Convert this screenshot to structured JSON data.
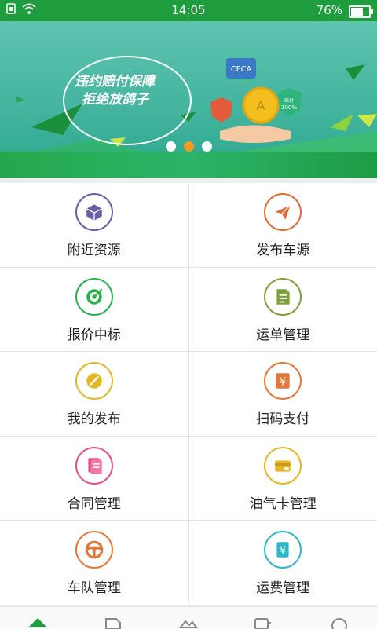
{
  "status_bar": {
    "time": "14:05",
    "battery": "76%",
    "battery_level": 0.76
  },
  "banner": {
    "slogan_line1": "违约赔付保障",
    "slogan_line2": "拒绝放鸽子",
    "badge_cfca": "CFCA",
    "badge_percent": "100%",
    "badge_percent_label": "赔付",
    "carousel_active_index": 1,
    "carousel_count": 3
  },
  "menu": [
    {
      "label": "附近资源",
      "icon": "cube-icon",
      "color": "#6a5fa8"
    },
    {
      "label": "发布车源",
      "icon": "paper-plane-icon",
      "color": "#e06a3c"
    },
    {
      "label": "报价中标",
      "icon": "target-icon",
      "color": "#2bb24c"
    },
    {
      "label": "运单管理",
      "icon": "document-icon",
      "color": "#7ea23a"
    },
    {
      "label": "我的发布",
      "icon": "edit-icon",
      "color": "#e3b826"
    },
    {
      "label": "扫码支付",
      "icon": "scan-yuan-icon",
      "color": "#e07a3a"
    },
    {
      "label": "合同管理",
      "icon": "contract-icon",
      "color": "#e0528a"
    },
    {
      "label": "油气卡管理",
      "icon": "card-icon",
      "color": "#e3b826"
    },
    {
      "label": "车队管理",
      "icon": "steering-wheel-icon",
      "color": "#e07a3a"
    },
    {
      "label": "运费管理",
      "icon": "freight-yuan-icon",
      "color": "#2fb6c8"
    }
  ],
  "tabbar": {
    "tabs": [
      "home-tab-icon",
      "orders-tab-icon",
      "cargo-tab-icon",
      "truck-tab-icon",
      "profile-tab-icon"
    ]
  }
}
